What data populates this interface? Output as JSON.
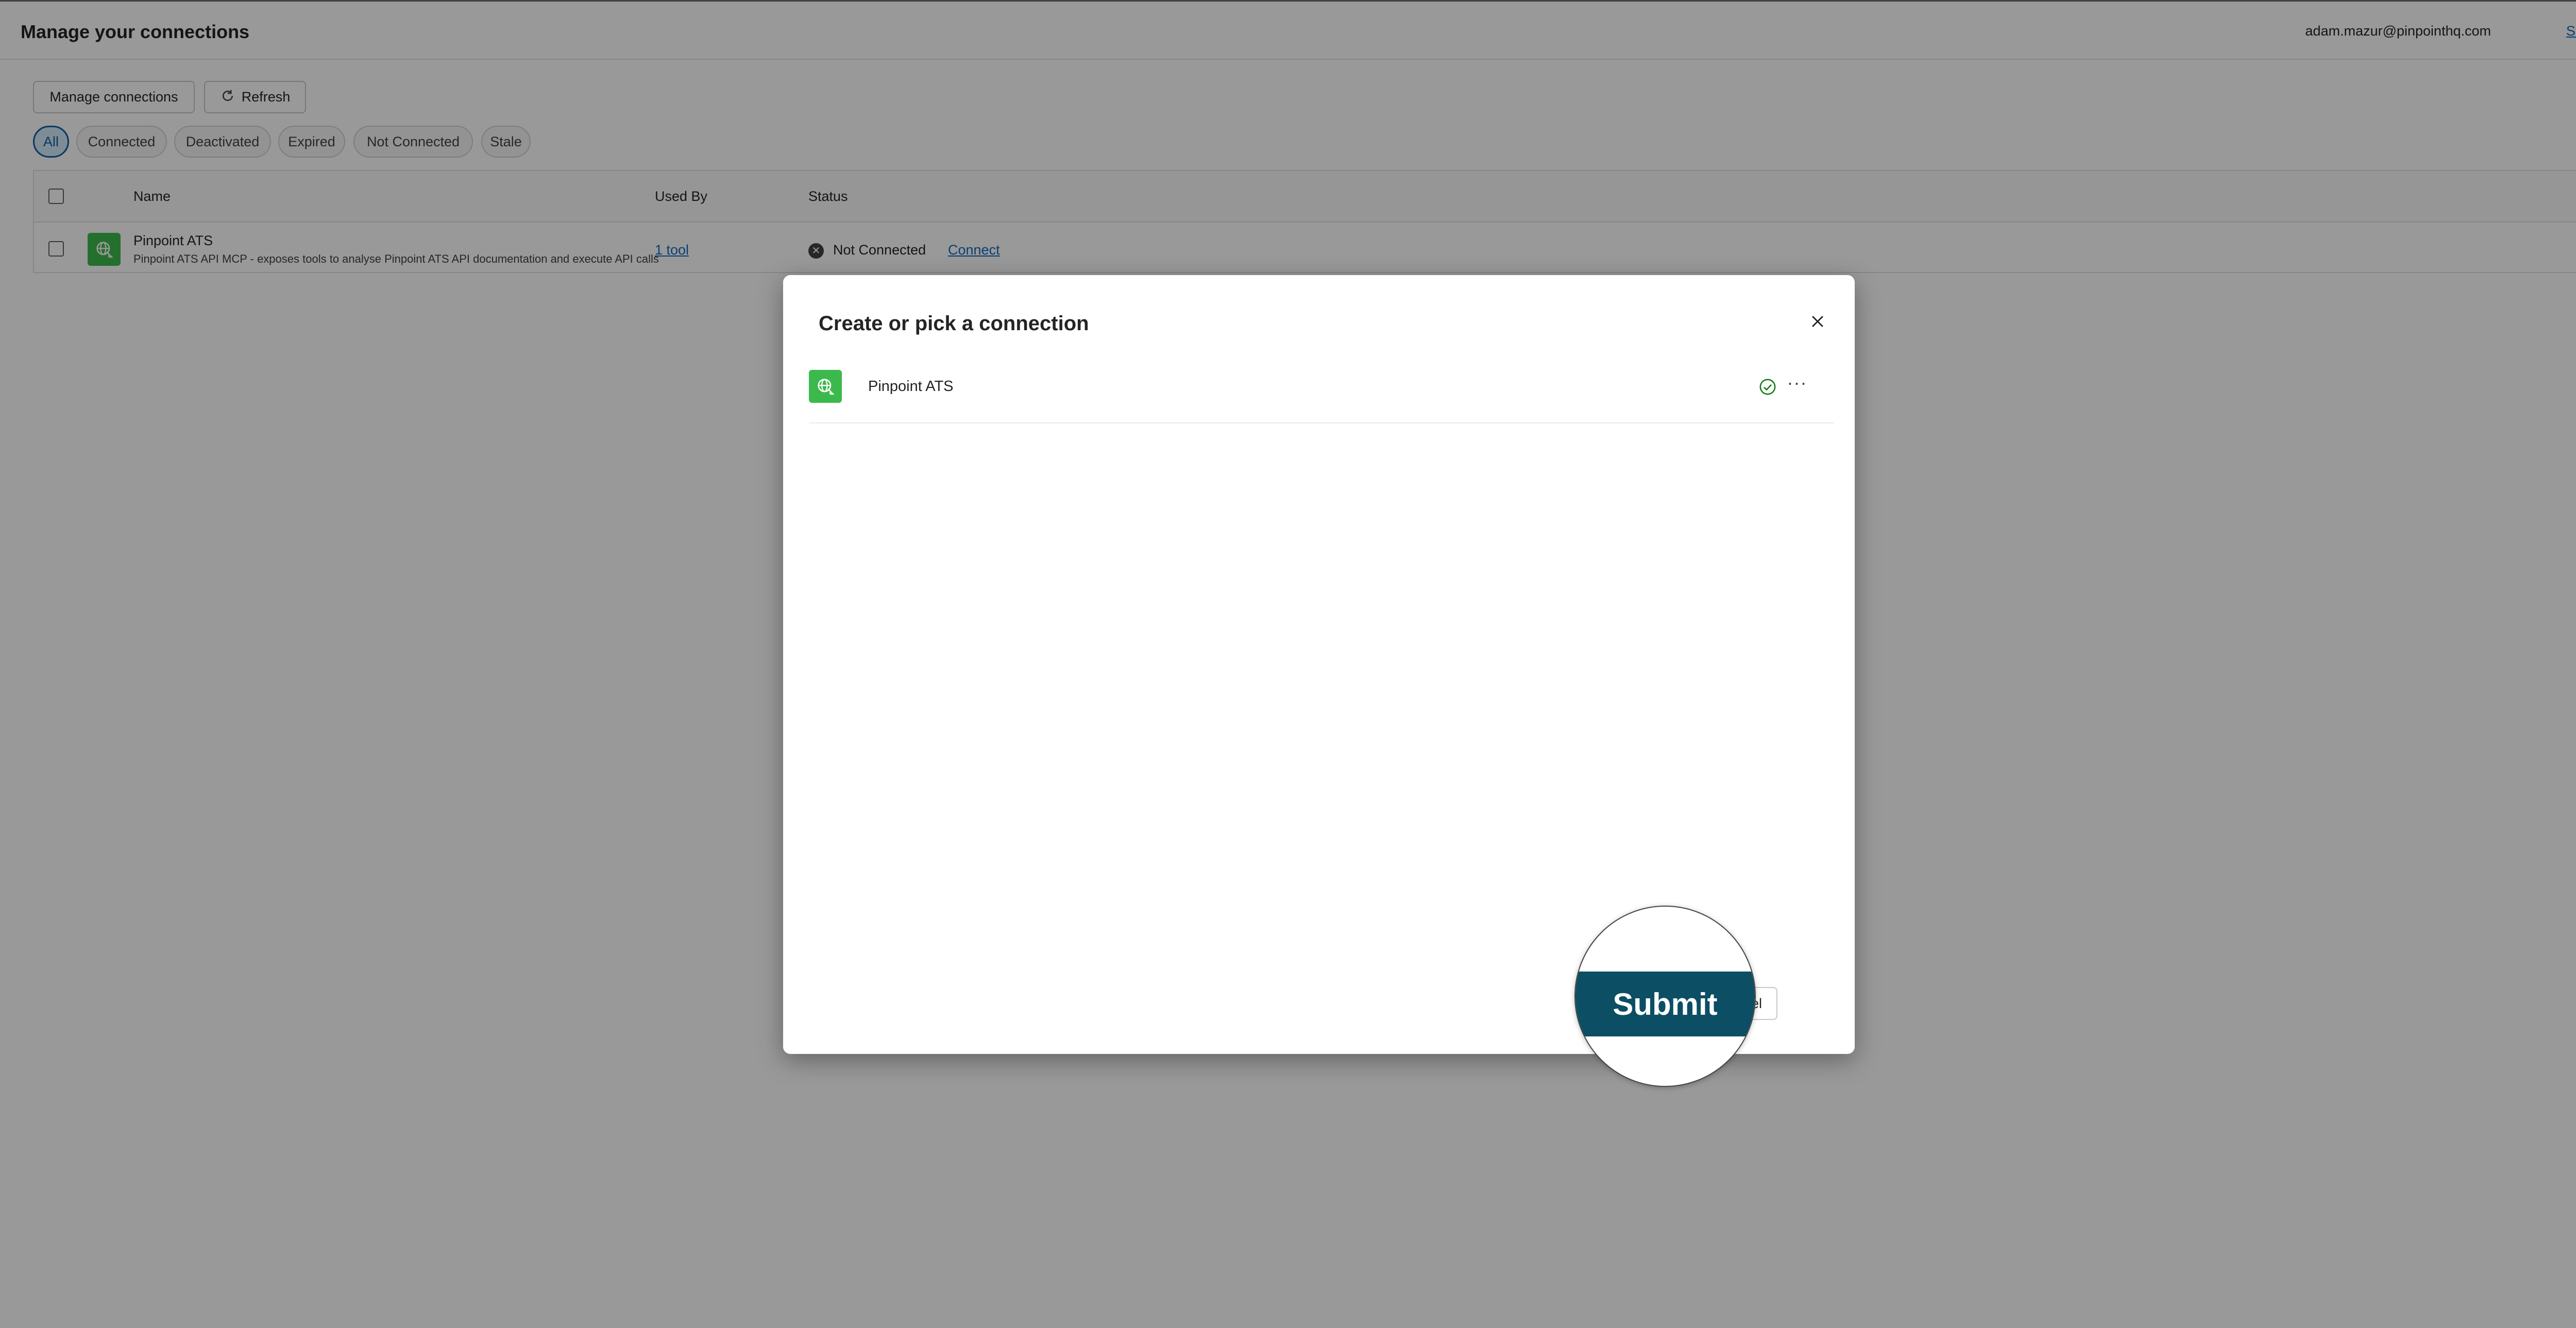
{
  "header": {
    "title": "Manage your connections",
    "user_email": "adam.mazur@pinpointhq.com",
    "sign_out": "Sign out"
  },
  "toolbar": {
    "manage_label": "Manage connections",
    "refresh_label": "Refresh",
    "refresh_icon": "refresh-icon"
  },
  "filters": [
    {
      "label": "All",
      "active": true
    },
    {
      "label": "Connected",
      "active": false
    },
    {
      "label": "Deactivated",
      "active": false
    },
    {
      "label": "Expired",
      "active": false
    },
    {
      "label": "Not Connected",
      "active": false
    },
    {
      "label": "Stale",
      "active": false
    }
  ],
  "table": {
    "columns": [
      "Name",
      "Used By",
      "Status"
    ],
    "rows": [
      {
        "name": "Pinpoint ATS",
        "description": "Pinpoint ATS API MCP - exposes tools to analyse Pinpoint ATS API documentation and execute API calls",
        "used_by": "1 tool",
        "status": "Not Connected",
        "action": "Connect"
      }
    ]
  },
  "dialog": {
    "title": "Create or pick a connection",
    "connection_name": "Pinpoint ATS",
    "more_label": "···",
    "cancel_label": "ancel",
    "submit_label": "Submit"
  },
  "colors": {
    "accent": "#0f6cbd",
    "submit": "#0c4e63",
    "connector_icon": "#3cb94c",
    "check": "#107c10"
  }
}
